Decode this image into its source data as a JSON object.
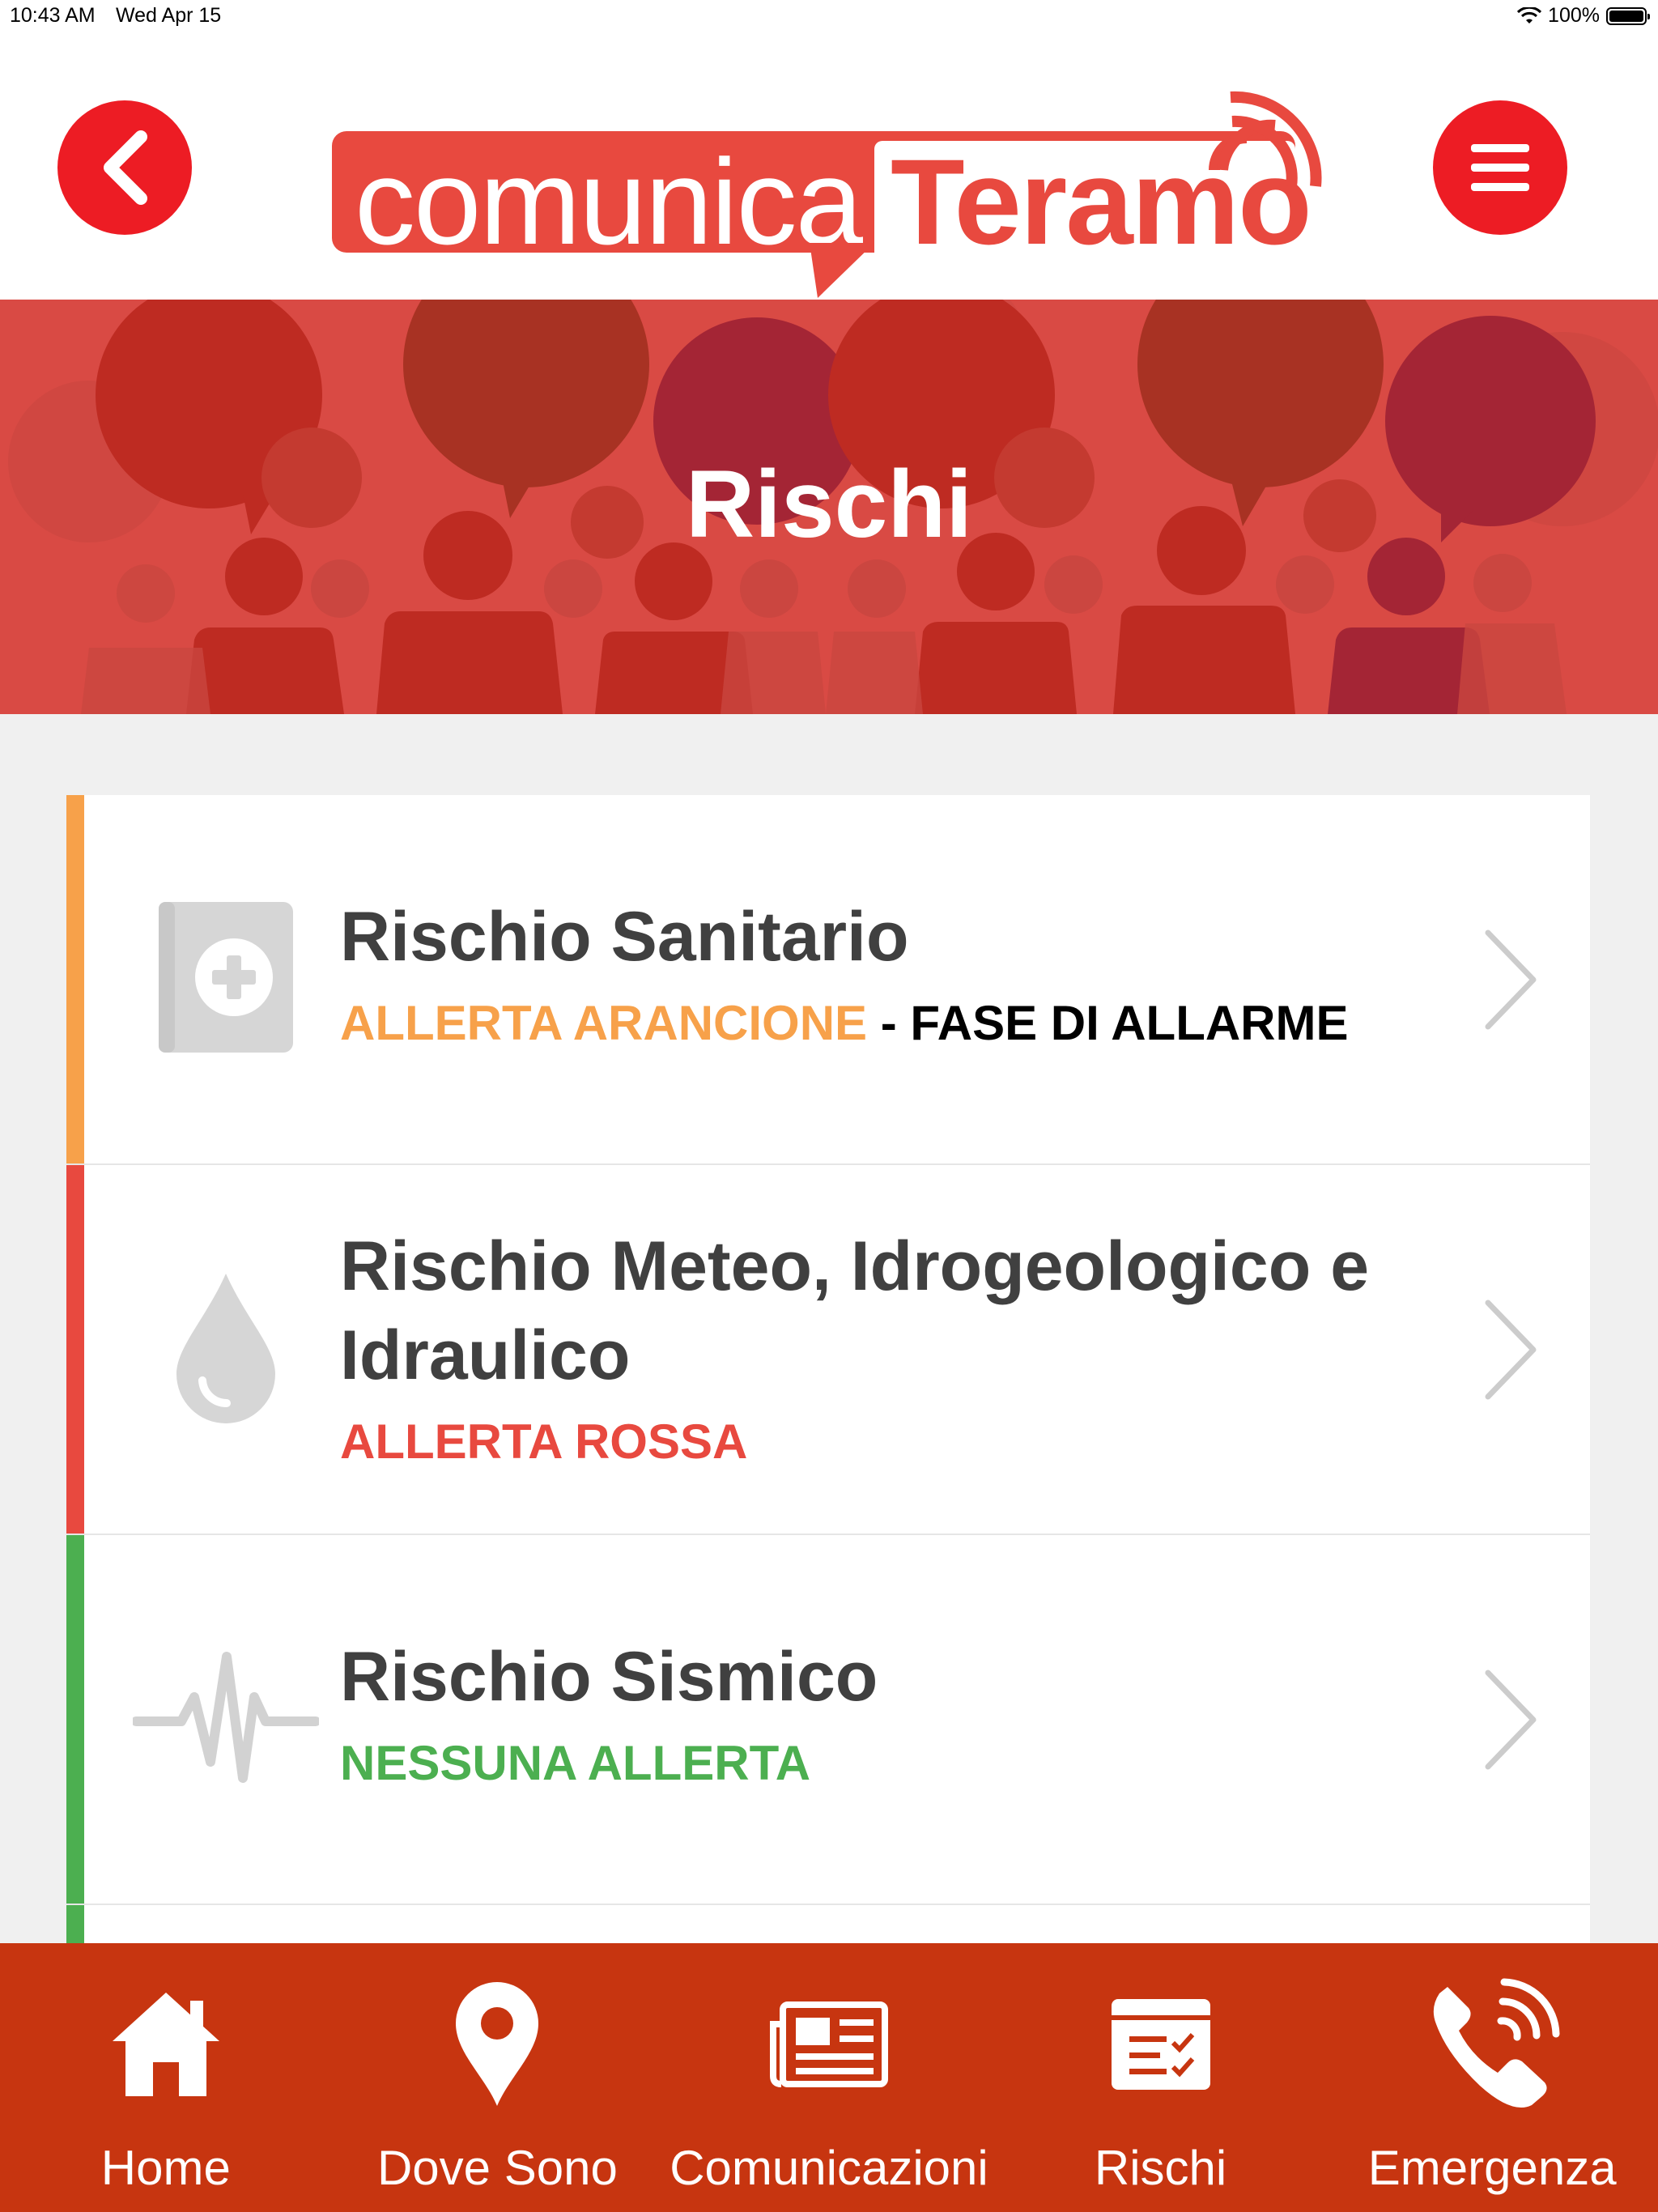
{
  "status_bar": {
    "time": "10:43 AM",
    "date": "Wed Apr 15",
    "battery": "100%"
  },
  "header": {
    "logo_left": "comunica",
    "logo_right": "Teramo",
    "back_icon": "chevron-left-icon",
    "menu_icon": "hamburger-menu-icon"
  },
  "banner": {
    "title": "Rischi"
  },
  "colors": {
    "brand_red": "#ed1c24",
    "tab_bar": "#c73510",
    "orange": "#f7a14a",
    "red": "#e8493f",
    "green": "#4caf50"
  },
  "risks": [
    {
      "title": "Rischio Sanitario",
      "status_label": "ALLERTA ARANCIONE",
      "status_suffix": " - FASE DI ALLARME",
      "color": "#f7a14a",
      "icon": "first-aid-kit-icon"
    },
    {
      "title": "Rischio Meteo, Idrogeologico e Idraulico",
      "status_label": "ALLERTA ROSSA",
      "status_suffix": "",
      "color": "#e8493f",
      "icon": "water-drop-icon"
    },
    {
      "title": "Rischio Sismico",
      "status_label": "NESSUNA ALLERTA",
      "status_suffix": "",
      "color": "#4caf50",
      "icon": "seismograph-icon"
    }
  ],
  "tabs": [
    {
      "label": "Home",
      "icon": "home-icon"
    },
    {
      "label": "Dove Sono",
      "icon": "location-pin-icon"
    },
    {
      "label": "Comunicazioni",
      "icon": "newspaper-icon"
    },
    {
      "label": "Rischi",
      "icon": "checklist-icon"
    },
    {
      "label": "Emergenza",
      "icon": "phone-call-icon"
    }
  ]
}
